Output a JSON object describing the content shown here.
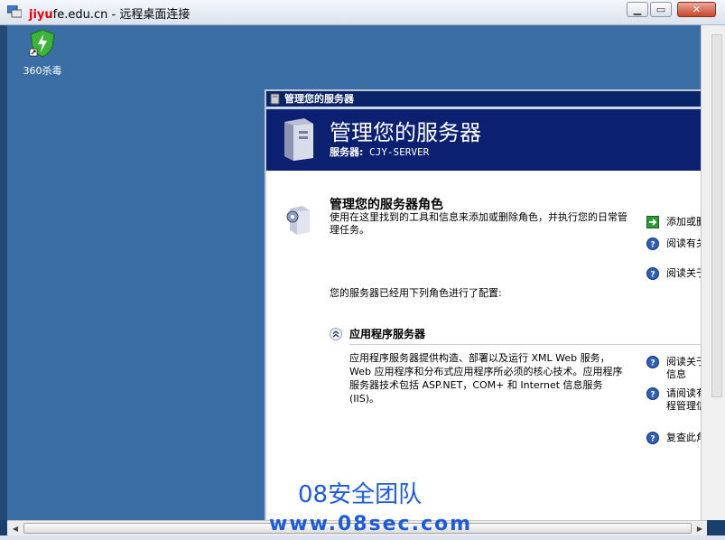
{
  "window": {
    "title_redacted": "jiyu",
    "title_rest": "fe.edu.cn - 远程桌面连接",
    "minimize_icon": "minimize-icon",
    "maximize_icon": "maximize-icon",
    "close_icon": "close-icon"
  },
  "desktop": {
    "icon_label": "360杀毒"
  },
  "manager": {
    "titlebar": "管理您的服务器",
    "heading": "管理您的服务器",
    "server_label": "服务器:",
    "server_name": "CJY-SERVER",
    "section_title": "管理您的服务器角色",
    "section_desc": "使用在这里找到的工具和信息来添加或删除角色，并执行您的日常管理任务。",
    "configured_text": "您的服务器已经用下列角色进行了配置:",
    "role_name": "应用程序服务器",
    "role_desc": "应用程序服务器提供构造、部署以及运行 XML Web 服务，Web 应用程序和分布式应用程序所必须的核心技术。应用程序服务器技术包括 ASP.NET，COM+ 和 Internet 信息服务(IIS)。",
    "links_top": [
      {
        "label": "添加或删",
        "icon": "green-arrow-icon"
      },
      {
        "label": "阅读有关息",
        "icon": "help-icon"
      },
      {
        "label": "阅读关于",
        "icon": "help-icon"
      }
    ],
    "links_role": [
      {
        "label": "阅读关于的信息",
        "icon": "help-icon"
      },
      {
        "label": "请阅读有远程管理信息",
        "icon": "help-icon"
      },
      {
        "label": "复查此角",
        "icon": "help-icon"
      }
    ]
  },
  "watermark": {
    "line1": "08安全团队",
    "line2": "www.08sec.com"
  }
}
